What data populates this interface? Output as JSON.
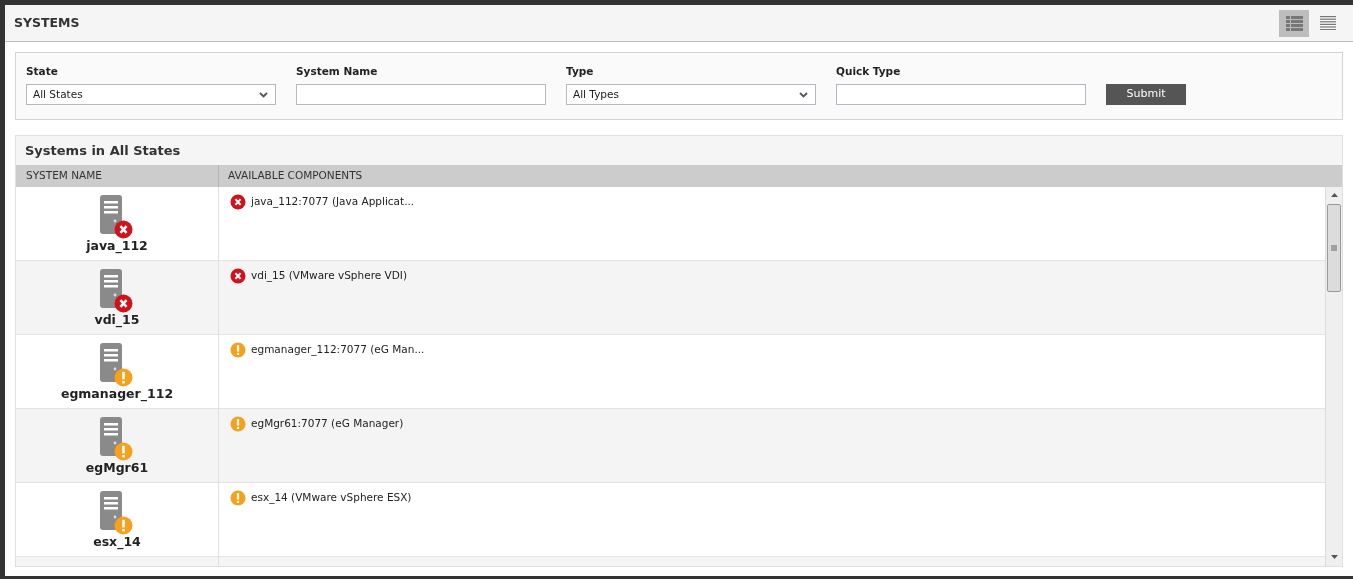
{
  "header": {
    "title": "SYSTEMS",
    "view_toggles": [
      {
        "kind": "detailed",
        "selected": true
      },
      {
        "kind": "compact",
        "selected": false
      }
    ]
  },
  "filters": {
    "fields": [
      {
        "label": "State",
        "kind": "select",
        "value": "All States"
      },
      {
        "label": "System Name",
        "kind": "text"
      },
      {
        "label": "Type",
        "kind": "select",
        "value": "All Types"
      },
      {
        "label": "Quick Type",
        "kind": "text"
      }
    ],
    "submit": "Submit"
  },
  "table": {
    "title": "Systems in All States",
    "columns": [
      "SYSTEM NAME",
      "AVAILABLE COMPONENTS"
    ],
    "rows": [
      {
        "system": "java_112",
        "kind": "error",
        "components": [
          {
            "name": "java_112:7077 (Java Applicat...",
            "kind": "error"
          }
        ]
      },
      {
        "system": "vdi_15",
        "kind": "error",
        "components": [
          {
            "name": "vdi_15 (VMware vSphere VDI)",
            "kind": "error"
          }
        ]
      },
      {
        "system": "egmanager_112",
        "kind": "warning",
        "components": [
          {
            "name": "egmanager_112:7077 (eG Man...",
            "kind": "warning"
          }
        ]
      },
      {
        "system": "egMgr61",
        "kind": "warning",
        "components": [
          {
            "name": "egMgr61:7077 (eG Manager)",
            "kind": "warning"
          }
        ]
      },
      {
        "system": "esx_14",
        "kind": "warning",
        "components": [
          {
            "name": "esx_14 (VMware vSphere ESX)",
            "kind": "warning"
          }
        ]
      }
    ]
  }
}
